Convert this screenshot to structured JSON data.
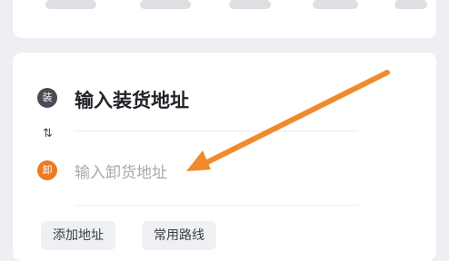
{
  "top_card": {},
  "route": {
    "load_badge": "装",
    "load_placeholder": "输入装货地址",
    "swap_icon": "⇅",
    "unload_badge": "卸",
    "unload_placeholder": "输入卸货地址"
  },
  "actions": {
    "add_address": "添加地址",
    "common_routes": "常用路线"
  },
  "annotation": {
    "arrow_color": "#f08a2c"
  },
  "colors": {
    "load_badge": "#4a4d55",
    "unload_badge": "#ee7a24"
  }
}
